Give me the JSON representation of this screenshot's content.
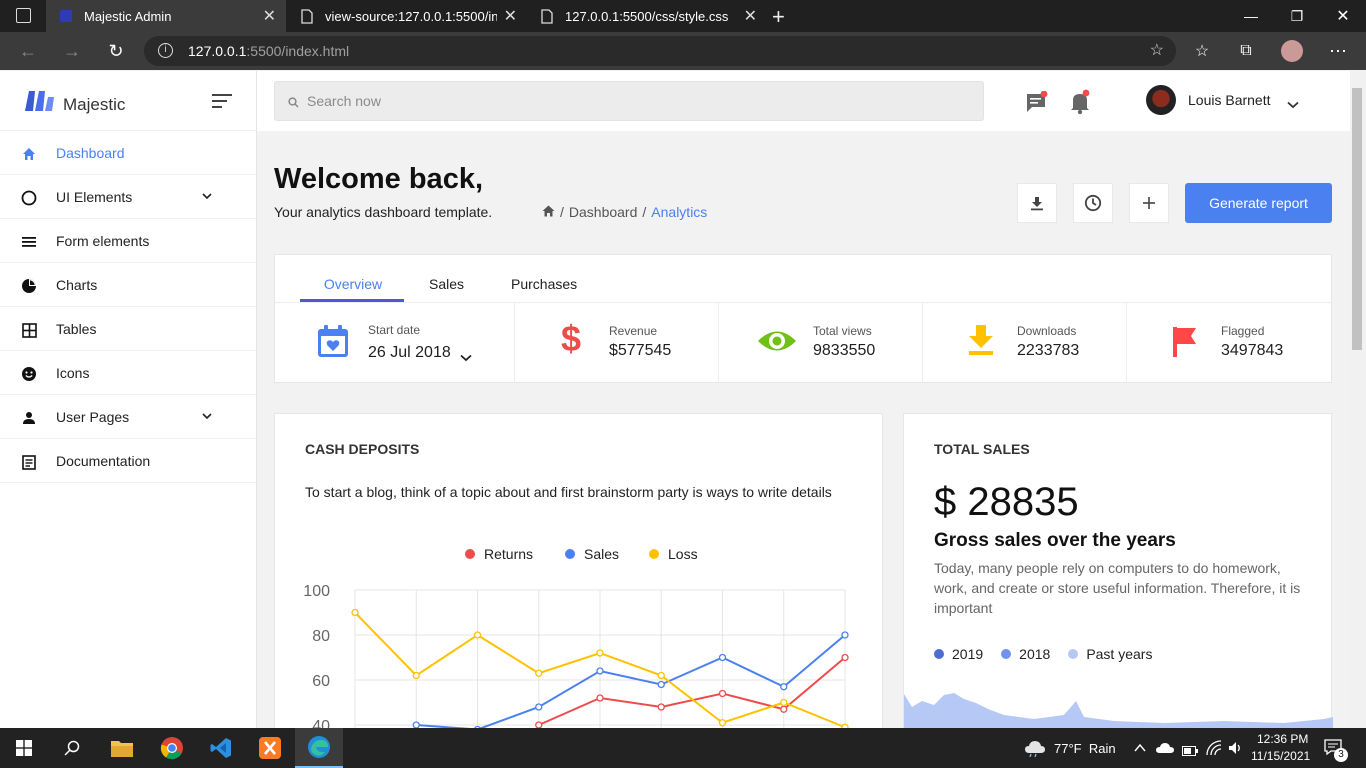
{
  "browser": {
    "tabs": [
      {
        "title": "Majestic Admin",
        "active": true
      },
      {
        "title": "view-source:127.0.0.1:5500/inde",
        "active": false
      },
      {
        "title": "127.0.0.1:5500/css/style.css",
        "active": false
      }
    ],
    "url_host": "127.0.0.1",
    "url_path": ":5500/index.html"
  },
  "sidebar": {
    "brand": "Majestic",
    "items": [
      {
        "label": "Dashboard",
        "icon": "home-icon",
        "active": true
      },
      {
        "label": "UI Elements",
        "icon": "circle-icon",
        "has_chevron": true
      },
      {
        "label": "Form elements",
        "icon": "list-icon"
      },
      {
        "label": "Charts",
        "icon": "pie-chart-icon"
      },
      {
        "label": "Tables",
        "icon": "table-icon"
      },
      {
        "label": "Icons",
        "icon": "smiley-icon"
      },
      {
        "label": "User Pages",
        "icon": "person-icon",
        "has_chevron": true
      },
      {
        "label": "Documentation",
        "icon": "document-icon"
      }
    ]
  },
  "topbar": {
    "search_placeholder": "Search now",
    "user_name": "Louis Barnett"
  },
  "header": {
    "title": "Welcome back,",
    "subtitle": "Your analytics dashboard template.",
    "breadcrumb_sep": "/",
    "breadcrumb_1": "Dashboard",
    "breadcrumb_2": "Analytics",
    "generate_label": "Generate report"
  },
  "tabs": [
    "Overview",
    "Sales",
    "Purchases"
  ],
  "stats": [
    {
      "label": "Start date",
      "value": "26 Jul 2018",
      "icon": "calendar-icon",
      "color": "#4a80f0"
    },
    {
      "label": "Revenue",
      "value": "$577545",
      "icon": "dollar-icon",
      "color": "#ee4b4b"
    },
    {
      "label": "Total views",
      "value": "9833550",
      "icon": "eye-icon",
      "color": "#71c016"
    },
    {
      "label": "Downloads",
      "value": "2233783",
      "icon": "download-icon",
      "color": "#ffc100"
    },
    {
      "label": "Flagged",
      "value": "3497843",
      "icon": "flag-icon",
      "color": "#ff4747"
    }
  ],
  "cash": {
    "title": "CASH DEPOSITS",
    "desc": "To start a blog, think of a topic about and first brainstorm party is ways to write details"
  },
  "chart_data": {
    "type": "line",
    "title": "",
    "xlabel": "",
    "ylabel": "",
    "ylim": [
      0,
      100
    ],
    "ytick_labels": [
      "100",
      "80",
      "60",
      "40"
    ],
    "legend_position": "top",
    "grid": true,
    "series": [
      {
        "name": "Returns",
        "color": "#ee4b4b",
        "values": [
          null,
          null,
          null,
          40,
          52,
          48,
          54,
          47,
          70
        ]
      },
      {
        "name": "Sales",
        "color": "#4a80f0",
        "values": [
          null,
          40,
          38,
          48,
          64,
          58,
          70,
          57,
          80
        ]
      },
      {
        "name": "Loss",
        "color": "#ffc100",
        "values": [
          90,
          62,
          80,
          63,
          72,
          62,
          41,
          50,
          39
        ]
      }
    ]
  },
  "sales": {
    "title": "TOTAL SALES",
    "amount": "$ 28835",
    "heading": "Gross sales over the years",
    "desc": "Today, many people rely on computers to do homework, work, and create or store useful information. Therefore, it is important",
    "legend": [
      {
        "label": "2019",
        "color": "#4c6fcf"
      },
      {
        "label": "2018",
        "color": "#6f93ee"
      },
      {
        "label": "Past years",
        "color": "#b6c8f5"
      }
    ]
  },
  "taskbar": {
    "weather": "77°F  Rain",
    "time": "12:36 PM",
    "date": "11/15/2021",
    "notif_count": "3"
  }
}
